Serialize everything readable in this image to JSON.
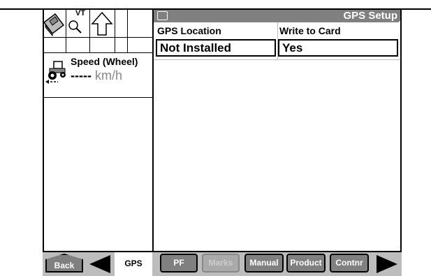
{
  "left_panel": {
    "toolbar_icons": [
      "book-icon",
      "vt-search-icon",
      "up-arrow-icon"
    ],
    "vt_label": "VT",
    "speed_title": "Speed (Wheel)",
    "speed_value": "-----",
    "speed_unit": "km/h"
  },
  "screen": {
    "title": "GPS Setup",
    "gps_location_label": "GPS Location",
    "gps_location_value": "Not Installed",
    "write_to_card_label": "Write to Card",
    "write_to_card_value": "Yes"
  },
  "bottom_bar": {
    "back": "Back",
    "gps": "GPS",
    "pf": "PF",
    "marks": "Marks",
    "manual": "Manual",
    "product": "Product",
    "contnr": "Contnr"
  },
  "colors": {
    "titlebar": "#808080",
    "button": "#808080",
    "bar": "#bdbdbd"
  }
}
